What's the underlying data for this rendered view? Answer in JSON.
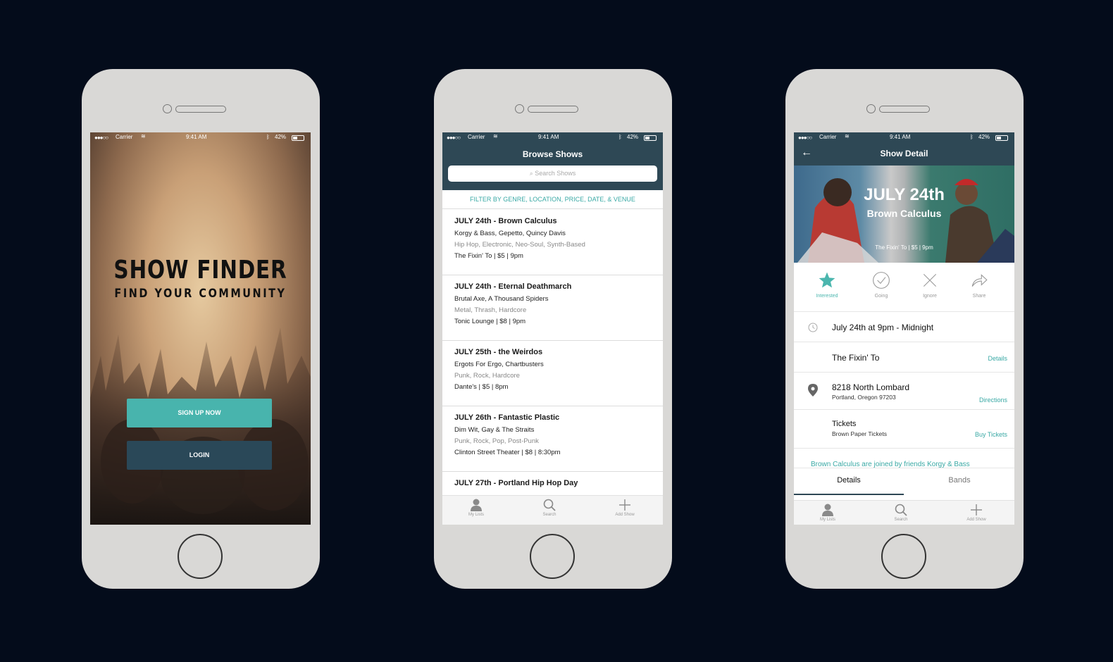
{
  "status": {
    "signal": "●●●○○",
    "carrier": "Carrier",
    "time": "9:41 AM",
    "battery": "42%"
  },
  "landing": {
    "title": "SHOW FINDER",
    "subtitle": "FIND YOUR COMMUNITY",
    "signup_label": "SIGN UP NOW",
    "login_label": "LOGIN"
  },
  "browse": {
    "title": "Browse Shows",
    "search_placeholder": "Search Shows",
    "filter_label": "FILTER BY GENRE, LOCATION, PRICE, DATE, & VENUE",
    "shows": [
      {
        "title": "JULY 24th - Brown Calculus",
        "lineup": "Korgy & Bass, Gepetto, Quincy Davis",
        "genres": "Hip Hop, Electronic, Neo-Soul, Synth-Based",
        "info": "The Fixin' To | $5 | 9pm"
      },
      {
        "title": "JULY 24th - Eternal Deathmarch",
        "lineup": "Brutal Axe, A Thousand Spiders",
        "genres": "Metal, Thrash, Hardcore",
        "info": "Tonic Lounge | $8 | 9pm"
      },
      {
        "title": "JULY 25th - the Weirdos",
        "lineup": "Ergots For Ergo, Chartbusters",
        "genres": "Punk, Rock, Hardcore",
        "info": "Dante's | $5 | 8pm"
      },
      {
        "title": "JULY 26th - Fantastic Plastic",
        "lineup": "Dim Wit, Gay & The Straits",
        "genres": "Punk, Rock, Pop, Post-Punk",
        "info": "Clinton Street Theater | $8 | 8:30pm"
      },
      {
        "title": "JULY 27th - Portland Hip Hop Day",
        "lineup": "",
        "genres": "",
        "info": ""
      }
    ]
  },
  "tabbar": {
    "lists": "My Lists",
    "search": "Search",
    "add": "Add Show"
  },
  "detail": {
    "title": "Show Detail",
    "date": "JULY 24th",
    "band": "Brown Calculus",
    "meta": "The Fixin' To | $5 | 9pm",
    "actions": {
      "interested": "Interested",
      "going": "Going",
      "ignore": "Ignore",
      "share": "Share"
    },
    "time": "July 24th at 9pm - Midnight",
    "venue": "The Fixin' To",
    "venue_link": "Details",
    "address": "8218 North Lombard",
    "city": "Portland, Oregon 97203",
    "address_link": "Directions",
    "tickets": "Tickets",
    "tickets_vendor": "Brown Paper Tickets",
    "tickets_link": "Buy Tickets",
    "description": "Brown Calculus are joined by friends Korgy & Bass",
    "tabs": {
      "details": "Details",
      "bands": "Bands"
    }
  },
  "colors": {
    "accent": "#48b4ad",
    "navy": "#2e4855",
    "background": "#040c1b"
  }
}
